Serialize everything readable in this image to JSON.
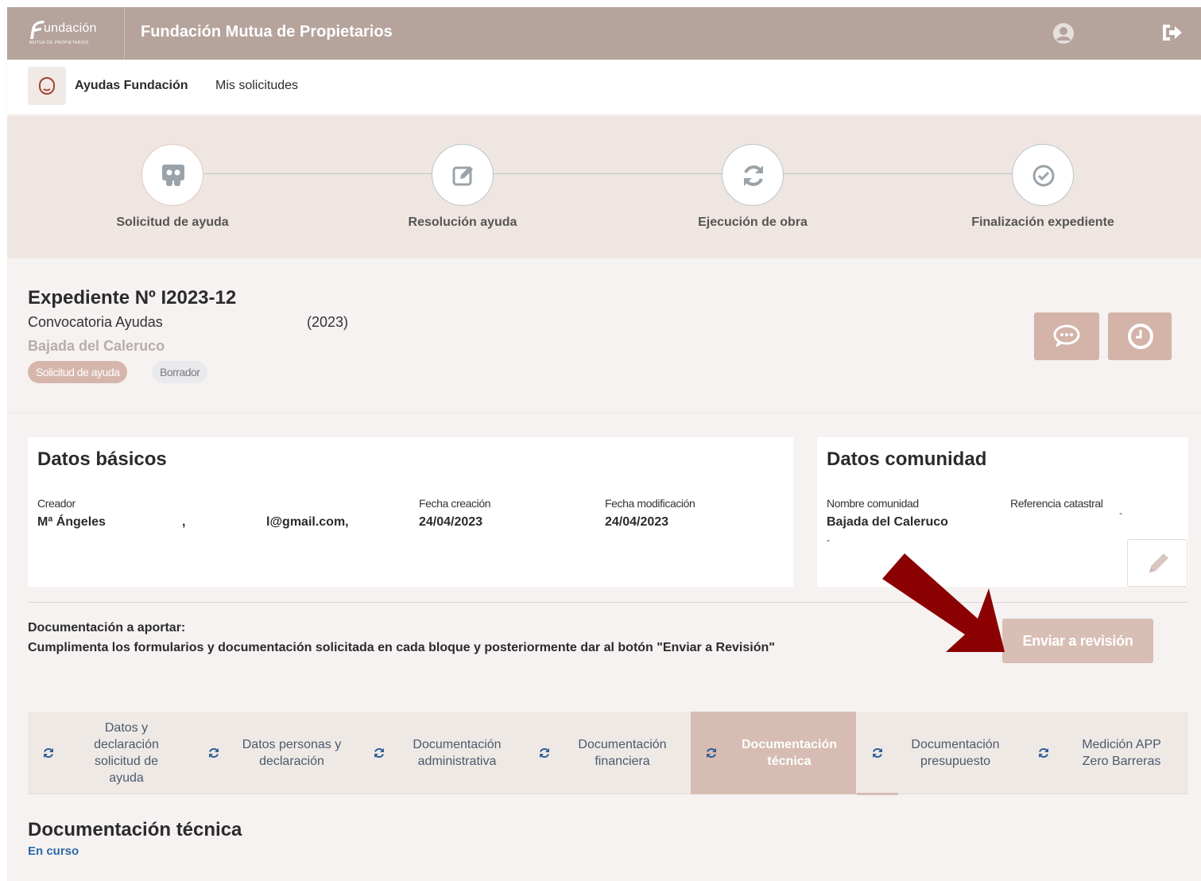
{
  "header": {
    "logo_text": "undación",
    "logo_sub": "MUTUA DE PROPIETARIOS",
    "app_title": "Fundación Mutua de Propietarios"
  },
  "nav": {
    "items": [
      {
        "label": "Ayudas Fundación"
      },
      {
        "label": "Mis solicitudes"
      }
    ]
  },
  "steps": [
    {
      "label": "Solicitud de ayuda",
      "icon": "users-icon",
      "active": true
    },
    {
      "label": "Resolución ayuda",
      "icon": "edit-icon",
      "active": false
    },
    {
      "label": "Ejecución de obra",
      "icon": "refresh-icon",
      "active": false
    },
    {
      "label": "Finalización expediente",
      "icon": "check-circle-icon",
      "active": false
    }
  ],
  "expediente": {
    "title": "Expediente Nº I2023-12",
    "convocatoria": "Convocatoria Ayudas",
    "year": "(2023)",
    "location": "Bajada del Caleruco",
    "badges": [
      {
        "label": "Solicitud de ayuda"
      },
      {
        "label": "Borrador"
      }
    ]
  },
  "datos_basicos": {
    "title": "Datos básicos",
    "creador_label": "Creador",
    "creador_name": "Mª Ángeles",
    "creador_sep": ",",
    "creador_email": "l@gmail.com,",
    "fecha_creacion_label": "Fecha creación",
    "fecha_creacion": "24/04/2023",
    "fecha_mod_label": "Fecha modificación",
    "fecha_mod": "24/04/2023"
  },
  "datos_comunidad": {
    "title": "Datos comunidad",
    "nombre_label": "Nombre comunidad",
    "nombre": "Bajada del Caleruco",
    "ref_label": "Referencia catastral",
    "ref_value": "-",
    "extra": "-"
  },
  "documentacion": {
    "title": "Documentación a aportar:",
    "description": "Cumplimenta los formularios y documentación solicitada en cada bloque y posteriormente dar al botón \"Enviar a Revisión\"",
    "send_button": "Enviar a revisión"
  },
  "tabs": [
    {
      "label": "Datos y declaración solicitud de ayuda"
    },
    {
      "label": "Datos personas y declaración"
    },
    {
      "label": "Documentación administrativa"
    },
    {
      "label": "Documentación financiera"
    },
    {
      "label": "Documentación técnica",
      "active": true
    },
    {
      "label": "Documentación presupuesto"
    },
    {
      "label": "Medición APP Zero Barreras"
    }
  ],
  "section": {
    "title": "Documentación técnica",
    "status": "En curso"
  },
  "colors": {
    "brand": "#b5a39c",
    "accent": "#d6bcb2",
    "annotation_arrow": "#8b0000",
    "status_link": "#2e6aa8"
  }
}
